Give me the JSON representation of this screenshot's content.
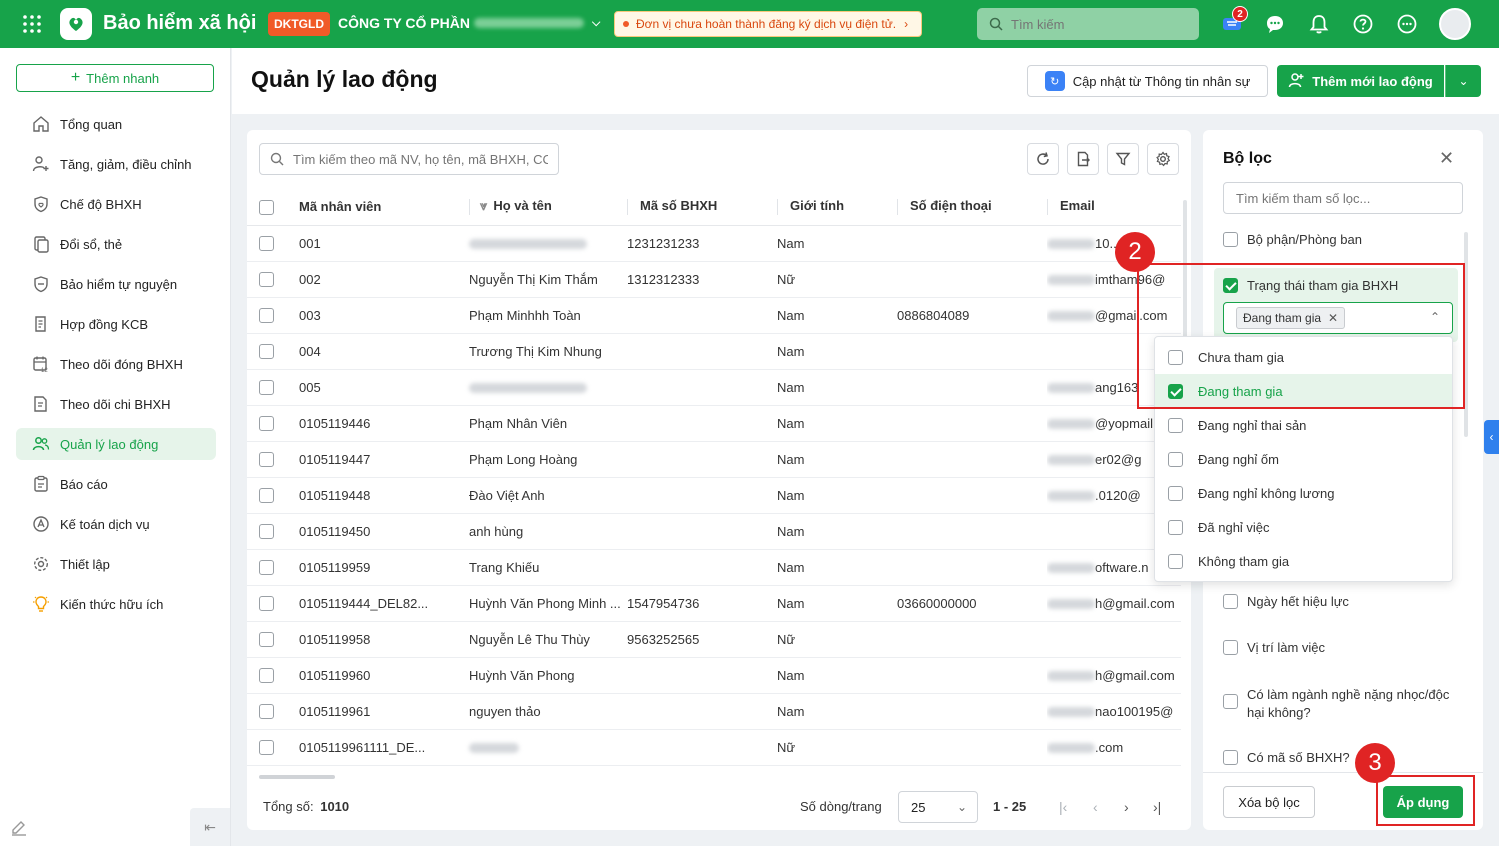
{
  "app": {
    "title": "Bảo hiểm xã hội",
    "company_badge": "DKTGLD",
    "company_name": "CÔNG TY CỔ PHẦN",
    "notice": "Đơn vị chưa hoàn thành đăng ký dịch vụ điện tử.",
    "search_placeholder": "Tìm kiếm",
    "cart_count": "2"
  },
  "sidebar": {
    "quick_add": "Thêm nhanh",
    "items": [
      {
        "label": "Tổng quan",
        "icon": "home-icon"
      },
      {
        "label": "Tăng, giảm, điều chỉnh",
        "icon": "person-adjust-icon"
      },
      {
        "label": "Chế độ BHXH",
        "icon": "shield-heart-icon"
      },
      {
        "label": "Đổi sổ, thẻ",
        "icon": "card-exchange-icon"
      },
      {
        "label": "Bảo hiểm tự nguyện",
        "icon": "shield-icon"
      },
      {
        "label": "Hợp đồng KCB",
        "icon": "contract-icon"
      },
      {
        "label": "Theo dõi đóng BHXH",
        "icon": "calendar-track-icon"
      },
      {
        "label": "Theo dõi chi BHXH",
        "icon": "document-track-icon"
      },
      {
        "label": "Quản lý lao động",
        "icon": "people-icon"
      },
      {
        "label": "Báo cáo",
        "icon": "report-icon"
      },
      {
        "label": "Kế toán dịch vụ",
        "icon": "accounting-icon"
      },
      {
        "label": "Thiết lập",
        "icon": "gear-icon"
      },
      {
        "label": "Kiến thức hữu ích",
        "icon": "bulb-icon"
      }
    ]
  },
  "page": {
    "title": "Quản lý lao động",
    "sync_button": "Cập nhật từ Thông tin nhân sự",
    "add_button": "Thêm mới lao động",
    "table_search_placeholder": "Tìm kiếm theo mã NV, họ tên, mã BHXH, CCCD"
  },
  "table": {
    "columns": [
      "Mã nhân viên",
      "Họ và tên",
      "Mã số BHXH",
      "Giới tính",
      "Số điện thoại",
      "Email"
    ],
    "rows": [
      {
        "code": "001",
        "name": "",
        "bhxh": "1231231233",
        "gender": "Nam",
        "phone": "",
        "email": "10...ail.co"
      },
      {
        "code": "002",
        "name": "Nguyễn Thị Kim Thắm",
        "bhxh": "1312312333",
        "gender": "Nữ",
        "phone": "",
        "email": "imtham96@"
      },
      {
        "code": "003",
        "name": "Phạm Minhhh Toàn",
        "bhxh": "",
        "gender": "Nam",
        "phone": "0886804089",
        "email": "@gmail.com"
      },
      {
        "code": "004",
        "name": "Trương Thị Kim Nhung",
        "bhxh": "",
        "gender": "Nam",
        "phone": "",
        "email": ""
      },
      {
        "code": "005",
        "name": "",
        "bhxh": "",
        "gender": "Nam",
        "phone": "",
        "email": "ang163"
      },
      {
        "code": "0105119446",
        "name": "Phạm Nhân Viên",
        "bhxh": "",
        "gender": "Nam",
        "phone": "",
        "email": "@yopmail"
      },
      {
        "code": "0105119447",
        "name": "Phạm Long Hoàng",
        "bhxh": "",
        "gender": "Nam",
        "phone": "",
        "email": "er02@g"
      },
      {
        "code": "0105119448",
        "name": "Đào Việt Anh",
        "bhxh": "",
        "gender": "Nam",
        "phone": "",
        "email": ".0120@"
      },
      {
        "code": "0105119450",
        "name": "anh hùng",
        "bhxh": "",
        "gender": "Nam",
        "phone": "",
        "email": ""
      },
      {
        "code": "0105119959",
        "name": "Trang Khiếu",
        "bhxh": "",
        "gender": "Nam",
        "phone": "",
        "email": "oftware.n"
      },
      {
        "code": "0105119444_DEL82...",
        "name": "Huỳnh Văn Phong Minh ...",
        "bhxh": "1547954736",
        "gender": "Nam",
        "phone": "03660000000",
        "email": "h@gmail.com"
      },
      {
        "code": "0105119958",
        "name": "Nguyễn Lê Thu Thùy",
        "bhxh": "9563252565",
        "gender": "Nữ",
        "phone": "",
        "email": ""
      },
      {
        "code": "0105119960",
        "name": "Huỳnh Văn Phong",
        "bhxh": "",
        "gender": "Nam",
        "phone": "",
        "email": "h@gmail.com"
      },
      {
        "code": "0105119961",
        "name": "nguyen thảo",
        "bhxh": "",
        "gender": "Nam",
        "phone": "",
        "email": "nao100195@"
      },
      {
        "code": "0105119961111_DE...",
        "name": "",
        "bhxh": "",
        "gender": "Nữ",
        "phone": "",
        "email": ".com"
      }
    ]
  },
  "footer": {
    "total_label": "Tổng số:",
    "total_value": "1010",
    "rows_per_page_label": "Số dòng/trang",
    "rows_per_page_value": "25",
    "range": "1 - 25"
  },
  "filter": {
    "title": "Bộ lọc",
    "search_placeholder": "Tìm kiếm tham số lọc...",
    "items_top": [
      "Bộ phận/Phòng ban",
      "Trạng thái tham gia BHXH"
    ],
    "selected_tag": "Đang tham gia",
    "options": [
      {
        "label": "Chưa tham gia",
        "checked": false
      },
      {
        "label": "Đang tham gia",
        "checked": true
      },
      {
        "label": "Đang nghỉ thai sản",
        "checked": false
      },
      {
        "label": "Đang nghỉ ốm",
        "checked": false
      },
      {
        "label": "Đang nghỉ không lương",
        "checked": false
      },
      {
        "label": "Đã nghỉ việc",
        "checked": false
      },
      {
        "label": "Không tham gia",
        "checked": false
      }
    ],
    "items_bottom": [
      "Ngày hết hiệu lực",
      "Vị trí làm việc",
      "Có làm ngành nghề nặng nhọc/độc hại không?",
      "Có mã số BHXH?"
    ],
    "clear_button": "Xóa bộ lọc",
    "apply_button": "Áp dụng"
  },
  "annotations": {
    "step2": "2",
    "step3": "3"
  },
  "colors": {
    "brand": "#17a34a",
    "annotation_red": "#e02424",
    "badge_orange": "#f05a28"
  }
}
